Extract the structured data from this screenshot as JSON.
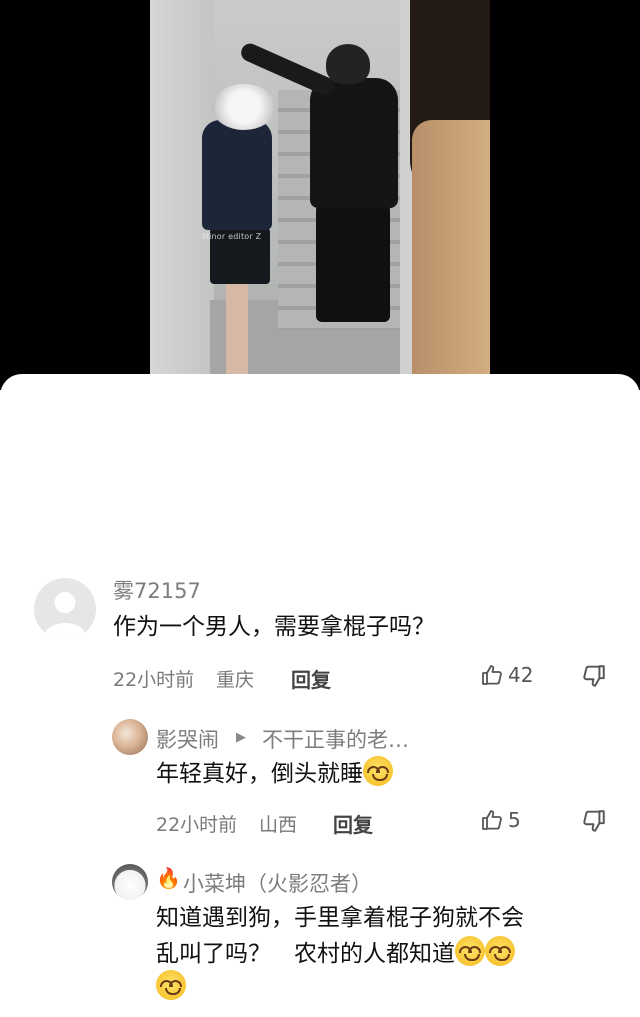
{
  "video": {
    "watermark": "Minor editor Z"
  },
  "comments": [
    {
      "username": "雾72157",
      "text": "作为一个男人，需要拿棍子吗？",
      "time": "22小时前",
      "location": "重庆",
      "reply_label": "回复",
      "likes": "42"
    }
  ],
  "replies": [
    {
      "username": "影哭闹",
      "reply_to": "不干正事的老…",
      "text": "年轻真好，倒头就睡",
      "time": "22小时前",
      "location": "山西",
      "reply_label": "回复",
      "likes": "5"
    },
    {
      "username": "小菜坤（火影忍者）",
      "text_line1": "知道遇到狗，手里拿着棍子狗就不会",
      "text_line2": "乱叫了吗？　农村的人都知道"
    }
  ],
  "icons": {
    "like": "thumbs-up-icon",
    "dislike": "thumbs-down-icon",
    "emoji": "grinning-face-emoji",
    "fire": "fire-icon",
    "arrow": "play-triangle-icon"
  },
  "colors": {
    "username": "#7d7d7d",
    "text": "#111111",
    "meta": "#7a7a7a"
  }
}
